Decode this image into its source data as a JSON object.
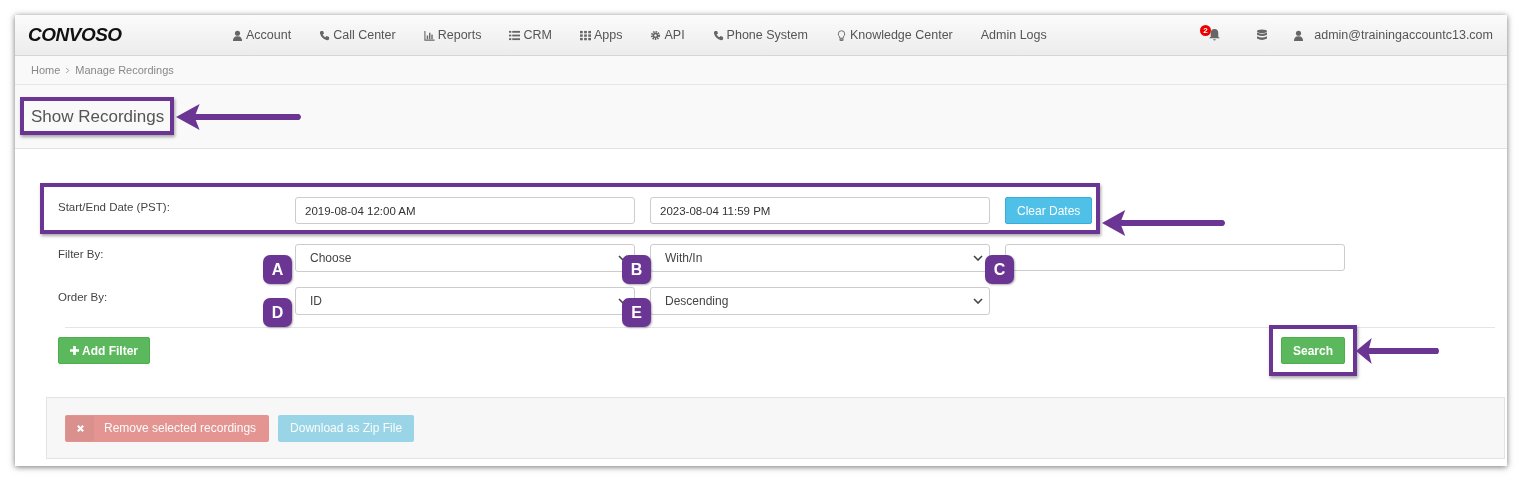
{
  "navbar": {
    "logo": "CONVOSO",
    "items": [
      {
        "label": "Account",
        "kind": "user"
      },
      {
        "label": "Call Center",
        "kind": "phone"
      },
      {
        "label": "Reports",
        "kind": "chart"
      },
      {
        "label": "CRM",
        "kind": "list"
      },
      {
        "label": "Apps",
        "kind": "grid"
      },
      {
        "label": "API",
        "kind": "gear"
      },
      {
        "label": "Phone System",
        "kind": "phone"
      },
      {
        "label": "Knowledge Center",
        "kind": "bulb"
      },
      {
        "label": "Admin Logs"
      }
    ],
    "notification_count": "2",
    "user": "admin@trainingaccountc13.com"
  },
  "breadcrumb": [
    "Home",
    "Manage Recordings"
  ],
  "page_title": {
    "text": "Show Recordings",
    "highlighted": true
  },
  "date_row": {
    "label": "Start/End Date (PST):",
    "start": "2019-08-04 12:00 AM",
    "end": "2023-08-04 11:59 PM",
    "button": "Clear Dates",
    "highlighted": true
  },
  "filter_row": {
    "label": "Filter By:",
    "field": {
      "value": "Choose",
      "badge": "A"
    },
    "operator": {
      "value": "With/In",
      "badge": "B"
    },
    "input": {
      "badge": "C"
    }
  },
  "order_row": {
    "label": "Order By:",
    "field": {
      "value": "ID",
      "badge": "D"
    },
    "direction": {
      "value": "Descending",
      "badge": "E"
    }
  },
  "add_filter": "Add Filter",
  "search": {
    "label": "Search",
    "highlighted": true
  },
  "actions": [
    {
      "label": "Remove selected recordings",
      "kind": "danger",
      "disabled": true
    },
    {
      "label": "Download as Zip File",
      "kind": "info",
      "disabled": true
    }
  ]
}
